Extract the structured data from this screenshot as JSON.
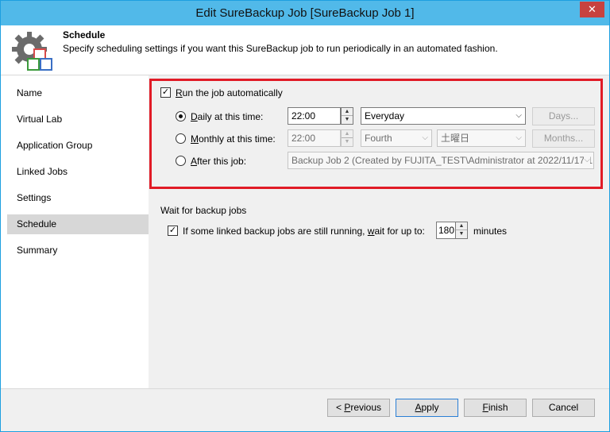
{
  "window": {
    "title": "Edit SureBackup Job [SureBackup Job 1]",
    "close_glyph": "✕"
  },
  "header": {
    "icon": "gear-with-boxes-icon",
    "title": "Schedule",
    "description": "Specify scheduling settings if you want this SureBackup job to run periodically in an automated fashion."
  },
  "sidebar": {
    "items": [
      {
        "label": "Name"
      },
      {
        "label": "Virtual Lab"
      },
      {
        "label": "Application Group"
      },
      {
        "label": "Linked Jobs"
      },
      {
        "label": "Settings"
      },
      {
        "label": "Schedule"
      },
      {
        "label": "Summary"
      }
    ],
    "active_index": 5
  },
  "schedule": {
    "run_auto": {
      "label_pre": "R",
      "label_post": "un the job automatically",
      "checked": true
    },
    "daily": {
      "label_pre": "D",
      "label_post": "aily at this time:",
      "checked": true,
      "time": "22:00",
      "frequency": "Everyday",
      "days_button": "Days..."
    },
    "monthly": {
      "label_pre": "M",
      "label_post": "onthly at this time:",
      "checked": false,
      "time": "22:00",
      "week": "Fourth",
      "day": "土曜日",
      "months_button": "Months..."
    },
    "after": {
      "label_pre": "A",
      "label_post": "fter this job:",
      "checked": false,
      "job": "Backup Job 2 (Created by FUJITA_TEST\\Administrator at 2022/11/17 1"
    }
  },
  "wait": {
    "section_title": "Wait for backup jobs",
    "checkbox_label_pre": "If some linked backup jobs are still running, ",
    "checkbox_label_u": "w",
    "checkbox_label_post": "ait for up to:",
    "checked": true,
    "minutes_value": "180",
    "minutes_unit": "minutes"
  },
  "footer": {
    "previous": {
      "pre": "< ",
      "u": "P",
      "post": "revious"
    },
    "apply": {
      "u": "A",
      "post": "pply"
    },
    "finish": {
      "u": "F",
      "post": "inish"
    },
    "cancel": "Cancel"
  },
  "colors": {
    "title_bar": "#51b9e9",
    "highlight_border": "#e11b26",
    "active_nav": "#d7d7d7"
  }
}
